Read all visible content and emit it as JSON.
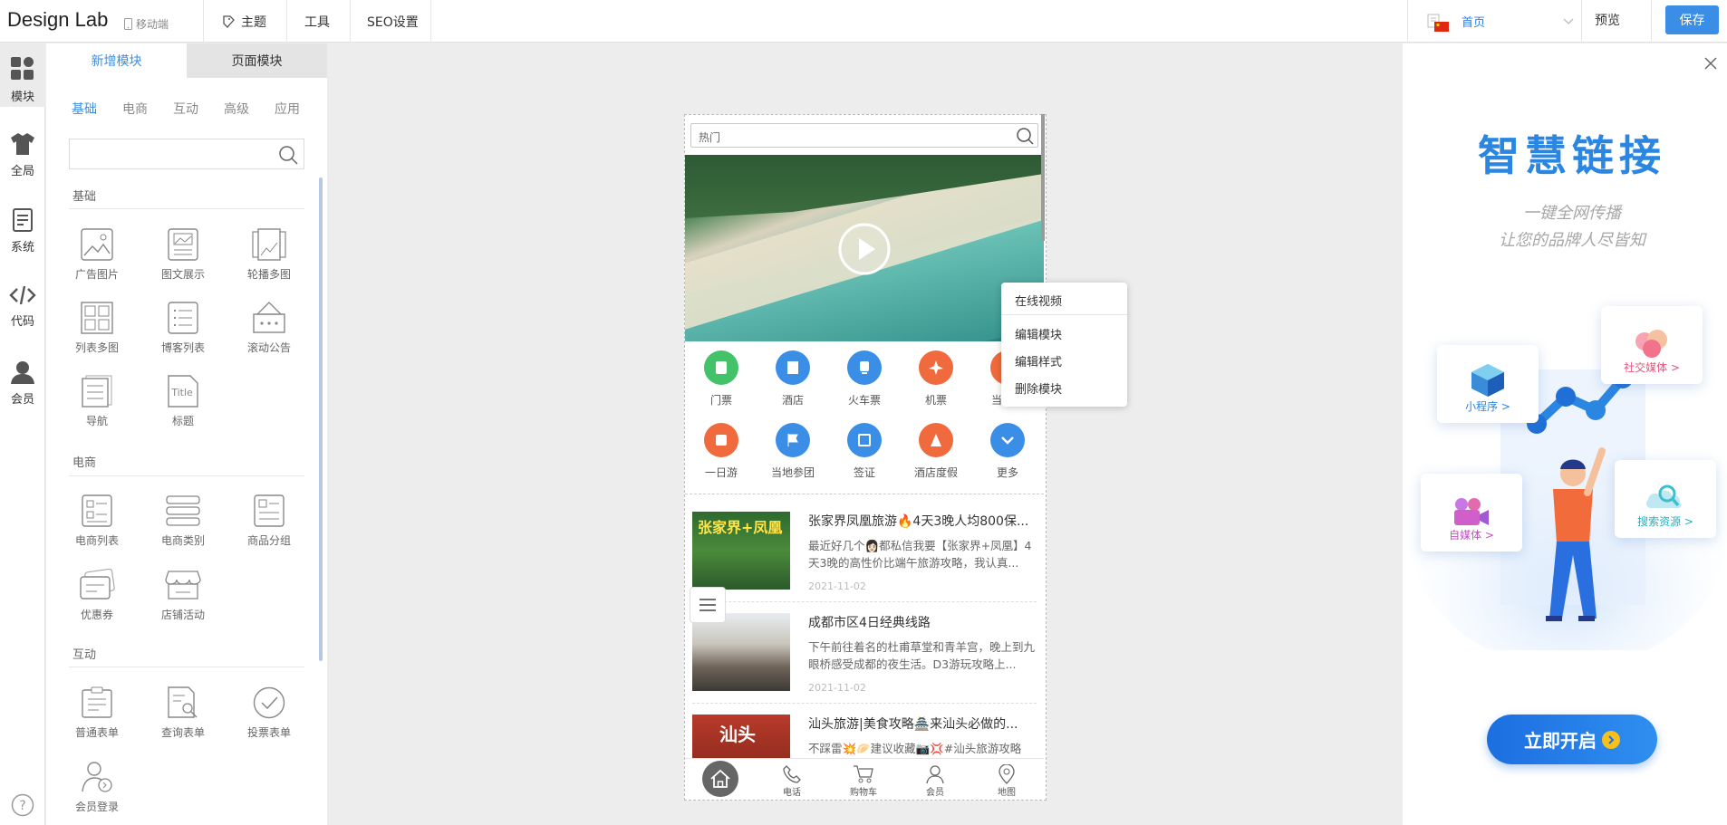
{
  "header": {
    "brand": "Design Lab",
    "mobile_label": "移动端",
    "menu": [
      "主题",
      "工具",
      "SEO设置"
    ],
    "page_select": "首页",
    "preview": "预览",
    "save": "保存"
  },
  "iconbar": {
    "items": [
      "模块",
      "全局",
      "系统",
      "代码",
      "会员"
    ]
  },
  "panel": {
    "tabs": [
      "新增模块",
      "页面模块"
    ],
    "category_tabs": [
      "基础",
      "电商",
      "互动",
      "高级",
      "应用"
    ],
    "search_placeholder": "",
    "sections": [
      {
        "title": "基础",
        "items": [
          "广告图片",
          "图文展示",
          "轮播多图",
          "列表多图",
          "博客列表",
          "滚动公告",
          "导航",
          "标题"
        ]
      },
      {
        "title": "电商",
        "items": [
          "电商列表",
          "电商类别",
          "商品分组",
          "优惠券",
          "店铺活动"
        ]
      },
      {
        "title": "互动",
        "items": [
          "普通表单",
          "查询表单",
          "投票表单",
          "会员登录"
        ]
      }
    ]
  },
  "phone": {
    "search_placeholder": "热门",
    "grid": [
      {
        "label": "门票",
        "color": "#43c26a"
      },
      {
        "label": "酒店",
        "color": "#3a8ee6"
      },
      {
        "label": "火车票",
        "color": "#3a8ee6"
      },
      {
        "label": "机票",
        "color": "#f06a3d"
      },
      {
        "label": "当地游",
        "color": "#f06a3d"
      },
      {
        "label": "一日游",
        "color": "#f06a3d"
      },
      {
        "label": "当地参团",
        "color": "#3a8ee6"
      },
      {
        "label": "签证",
        "color": "#3a8ee6"
      },
      {
        "label": "酒店度假",
        "color": "#f06a3d"
      },
      {
        "label": "更多",
        "color": "#3a8ee6"
      }
    ],
    "articles": [
      {
        "title": "张家界凤凰旅游🔥4天3晚人均800保...",
        "desc": "最近好几个👩🏻都私信我要【张家界+凤凰】4天3晚的高性价比端午旅游攻略，我认真...",
        "date": "2021-11-02",
        "thumb_text": "张家界+凤凰"
      },
      {
        "title": "成都市区4日经典线路",
        "desc": "下午前往着名的杜甫草堂和青羊宫，晚上到九眼桥感受成都的夜生活。D3游玩攻略上...",
        "date": "2021-11-02",
        "thumb_text": ""
      },
      {
        "title": "汕头旅游|美食攻略🏯来汕头必做的...",
        "desc": "不踩雷💥🥟建议收藏📷💢#汕头旅游攻略",
        "date": "",
        "thumb_text": "汕头"
      }
    ],
    "tabbar": [
      "电话",
      "购物车",
      "会员",
      "地图"
    ]
  },
  "context_menu": [
    "在线视频",
    "编辑模块",
    "编辑样式",
    "删除模块"
  ],
  "promo": {
    "title": "智慧链接",
    "subtitle1": "一键全网传播",
    "subtitle2": "让您的品牌人尽皆知",
    "cards": [
      "社交媒体 >",
      "小程序 >",
      "自媒体 >",
      "搜索资源 >"
    ],
    "cta": "立即开启"
  }
}
